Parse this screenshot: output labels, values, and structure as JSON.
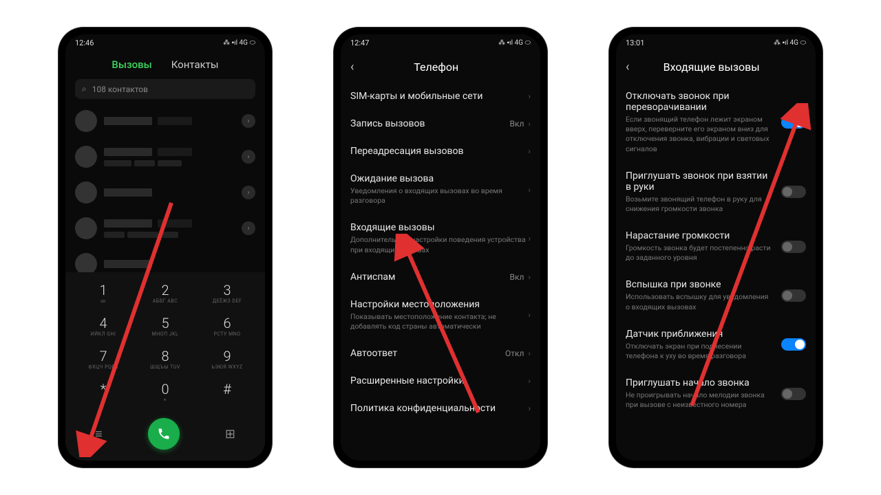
{
  "phone1": {
    "time": "12:46",
    "status": "⁂ ▪ıl 4G ⬭",
    "tabs": {
      "active": "Вызовы",
      "inactive": "Контакты"
    },
    "search_placeholder": "108 контактов",
    "dialpad": [
      {
        "n": "1",
        "s": "∞"
      },
      {
        "n": "2",
        "s": "АБВГ\nABC"
      },
      {
        "n": "3",
        "s": "ДЕЁЖЗ\nDEF"
      },
      {
        "n": "4",
        "s": "ИЙКЛ\nGHI"
      },
      {
        "n": "5",
        "s": "МНОП\nJKL"
      },
      {
        "n": "6",
        "s": "РСТУ\nMNO"
      },
      {
        "n": "7",
        "s": "ФХЦЧ\nPQRS"
      },
      {
        "n": "8",
        "s": "ШЩЪЫ\nTUV"
      },
      {
        "n": "9",
        "s": "ЬЭЮЯ\nWXYZ"
      },
      {
        "n": "*",
        "s": ""
      },
      {
        "n": "0",
        "s": "+"
      },
      {
        "n": "#",
        "s": ""
      }
    ]
  },
  "phone2": {
    "time": "12:47",
    "status": "⁂ ▪ıl 4G ⬭",
    "title": "Телефон",
    "items": [
      {
        "t": "SIM-карты и мобильные сети"
      },
      {
        "t": "Запись вызовов",
        "v": "Вкл"
      },
      {
        "t": "Переадресация вызовов"
      },
      {
        "t": "Ожидание вызова",
        "s": "Уведомления о входящих вызовах во время разговора"
      },
      {
        "t": "Входящие вызовы",
        "s": "Дополнительные настройки поведения устройства при входящих вызовах"
      },
      {
        "t": "Антиспам",
        "v": "Вкл"
      },
      {
        "t": "Настройки местоположения",
        "s": "Показывать местоположение контакта; не добавлять код страны автоматически"
      },
      {
        "t": "Автоответ",
        "v": "Откл"
      },
      {
        "t": "Расширенные настройки"
      },
      {
        "t": "Политика конфиденциальности"
      }
    ]
  },
  "phone3": {
    "time": "13:01",
    "status": "⁂ ▪ıl 4G ⬭",
    "title": "Входящие вызовы",
    "items": [
      {
        "t": "Отключать звонок при переворачивании",
        "s": "Если звонящий телефон лежит экраном вверх, переверните его экраном вниз для отключения звонка, вибрации и световых сигналов",
        "on": true
      },
      {
        "t": "Приглушать звонок при взятии в руки",
        "s": "Возьмите звонящий телефон в руку для снижения громкости звонка",
        "on": false
      },
      {
        "t": "Нарастание громкости",
        "s": "Громкость звонка будет постепенно расти до заданного уровня",
        "on": false
      },
      {
        "t": "Вспышка при звонке",
        "s": "Использовать вспышку для уведомления о входящих вызовах",
        "on": false
      },
      {
        "t": "Датчик приближения",
        "s": "Отключать экран при поднесении телефона к уху во время разговора",
        "on": true
      },
      {
        "t": "Приглушать начало звонка",
        "s": "Не проигрывать начало мелодии звонка при вызове с неизвестного номера",
        "on": false
      }
    ]
  }
}
